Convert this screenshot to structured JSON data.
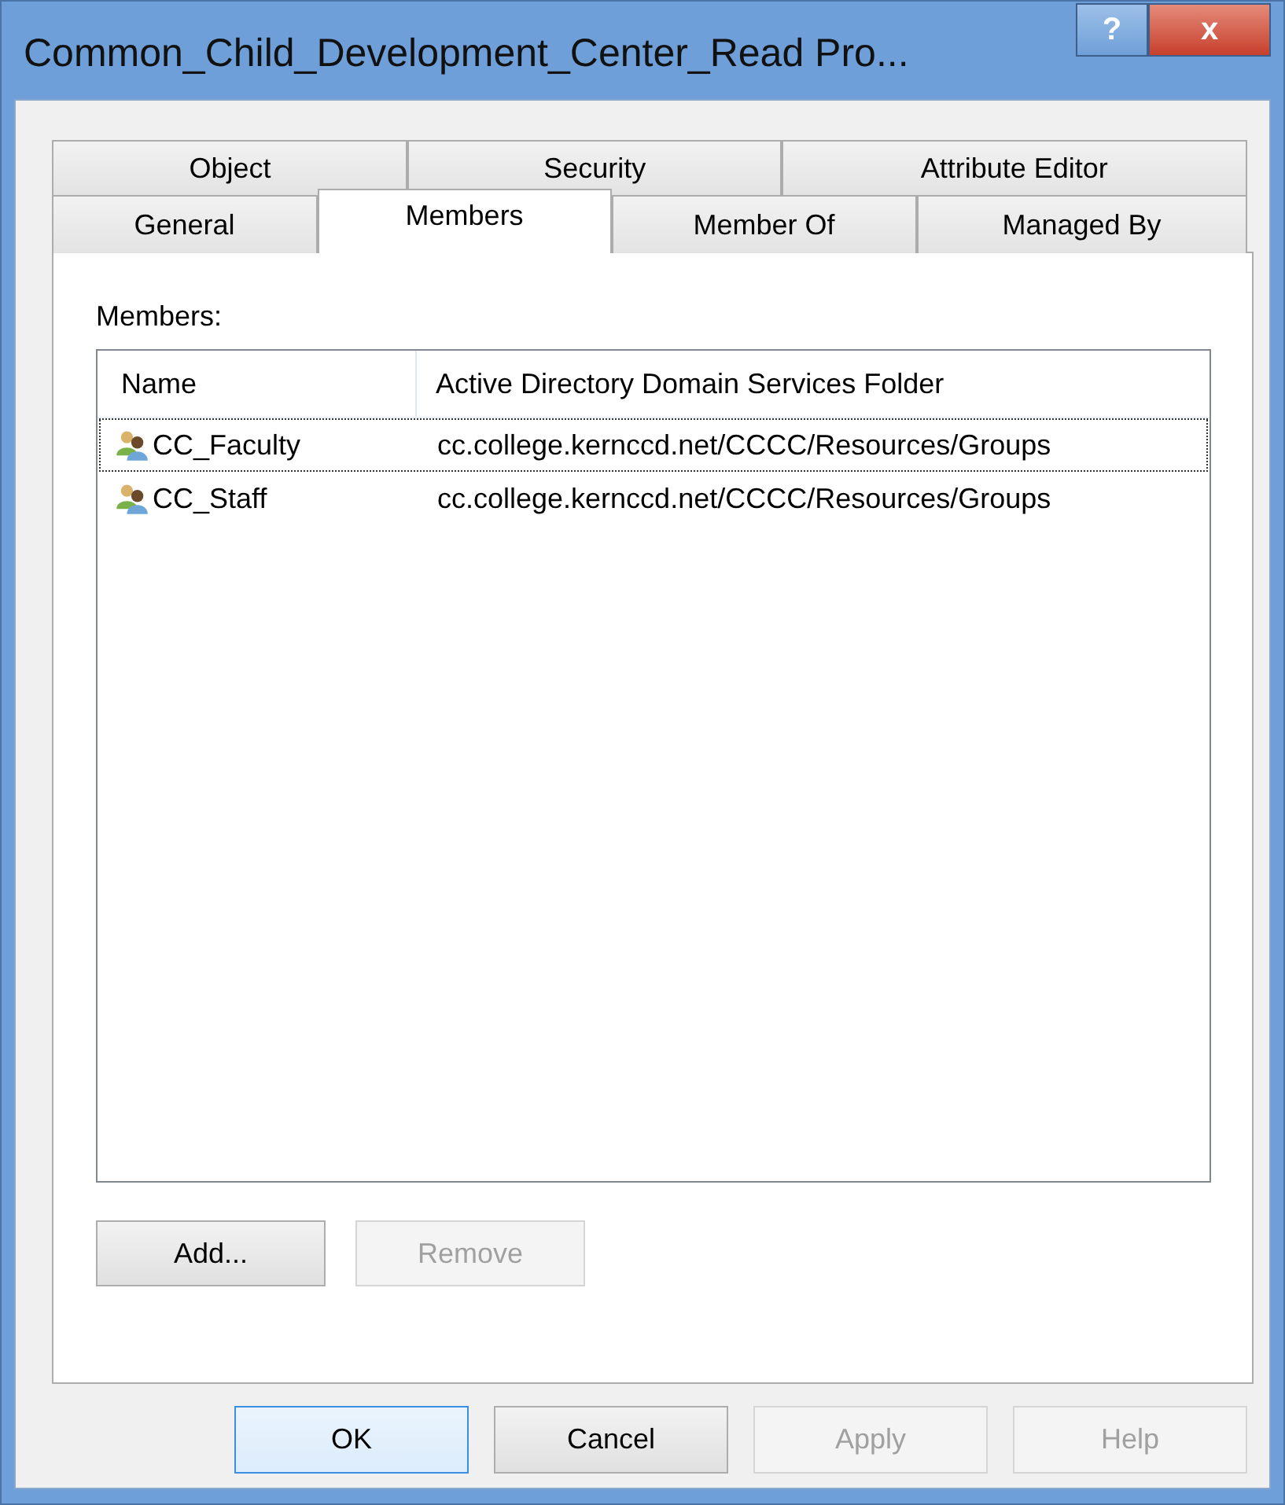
{
  "window": {
    "title": "Common_Child_Development_Center_Read Pro...",
    "help_button": "?",
    "close_button": "x"
  },
  "tab_rows": [
    [
      {
        "label": "Object",
        "selected": false
      },
      {
        "label": "Security",
        "selected": false
      },
      {
        "label": "Attribute Editor",
        "selected": false
      }
    ],
    [
      {
        "label": "General",
        "selected": false
      },
      {
        "label": "Members",
        "selected": true
      },
      {
        "label": "Member Of",
        "selected": false
      },
      {
        "label": "Managed By",
        "selected": false
      }
    ]
  ],
  "members_label": "Members:",
  "table": {
    "columns": [
      "Name",
      "Active Directory Domain Services Folder"
    ],
    "rows": [
      {
        "name": "CC_Faculty",
        "folder": "cc.college.kernccd.net/CCCC/Resources/Groups",
        "focused": true
      },
      {
        "name": "CC_Staff",
        "folder": "cc.college.kernccd.net/CCCC/Resources/Groups",
        "focused": false
      }
    ]
  },
  "list_buttons": [
    {
      "label": "Add...",
      "disabled": false
    },
    {
      "label": "Remove",
      "disabled": true
    }
  ],
  "dialog_buttons": [
    {
      "label": "OK",
      "disabled": false,
      "default": true
    },
    {
      "label": "Cancel",
      "disabled": false,
      "default": false
    },
    {
      "label": "Apply",
      "disabled": true,
      "default": false
    },
    {
      "label": "Help",
      "disabled": true,
      "default": false
    }
  ]
}
